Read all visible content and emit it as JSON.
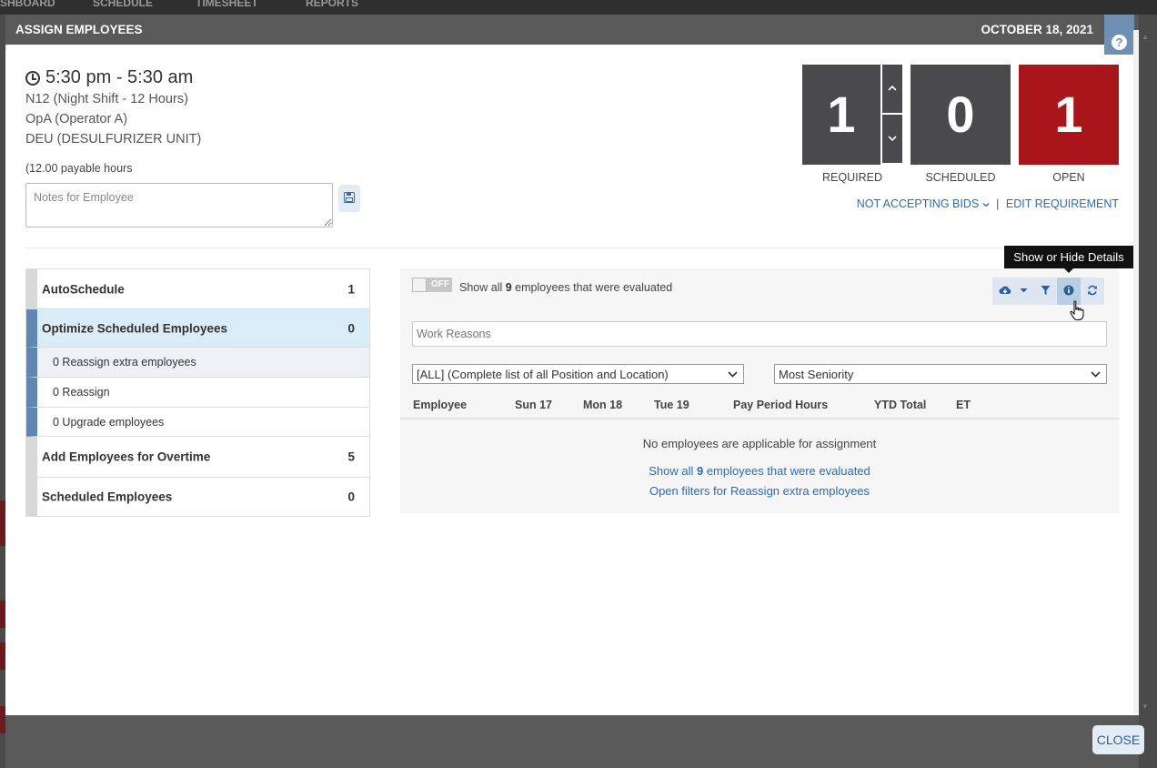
{
  "bg_nav": [
    "SHBOARD",
    "SCHEDULE",
    "TIMESHEET",
    "REPORTS"
  ],
  "modal": {
    "title": "ASSIGN EMPLOYEES",
    "date": "OCTOBER 18, 2021",
    "help_icon": "question-circle-icon"
  },
  "shift": {
    "time": "5:30 pm - 5:30 am",
    "lines": [
      "N12 (Night Shift - 12 Hours)",
      "OpA (Operator A)",
      "DEU (DESULFURIZER UNIT)"
    ],
    "payable": "(12.00 payable hours",
    "notes_placeholder": "Notes for Employee"
  },
  "counters": {
    "required": {
      "value": "1",
      "label": "REQUIRED"
    },
    "scheduled": {
      "value": "0",
      "label": "SCHEDULED"
    },
    "open": {
      "value": "1",
      "label": "OPEN"
    },
    "colors": {
      "dark": "#4a4a4c",
      "open": "#a8161b"
    }
  },
  "links": {
    "bids": "NOT ACCEPTING BIDS",
    "separator": "|",
    "edit": "EDIT REQUIREMENT"
  },
  "left_menu": {
    "items": [
      {
        "label": "AutoSchedule",
        "count": "1"
      },
      {
        "label": "Optimize Scheduled Employees",
        "count": "0"
      },
      {
        "label": "Add Employees for Overtime",
        "count": "5"
      },
      {
        "label": "Scheduled Employees",
        "count": "0"
      }
    ],
    "sub_items": [
      "0 Reassign extra employees",
      "0 Reassign",
      "0 Upgrade employees"
    ]
  },
  "panel": {
    "toggle": "OFF",
    "show_all_prefix": "Show all",
    "show_all_count": "9",
    "show_all_suffix": "employees that were evaluated",
    "work_reasons_placeholder": "Work Reasons",
    "position_select": "[ALL] (Complete list of all Position and Location)",
    "sort_select": "Most Seniority",
    "columns": [
      "Employee",
      "Sun 17",
      "Mon 18",
      "Tue 19",
      "Pay Period Hours",
      "YTD Total",
      "ET"
    ],
    "empty_message": "No employees are applicable for assignment",
    "link_show_prefix": "Show all",
    "link_show_count": "9",
    "link_show_suffix": "employees that were evaluated",
    "link_filters": "Open filters for Reassign extra employees"
  },
  "tooltip": "Show or Hide Details",
  "footer": {
    "close": "CLOSE"
  }
}
